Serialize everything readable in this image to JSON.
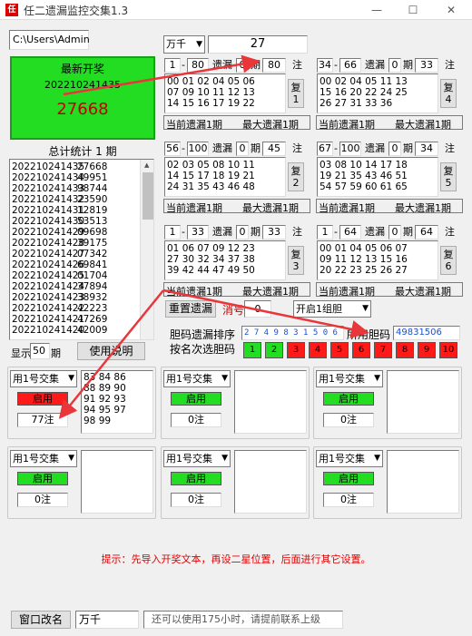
{
  "window": {
    "title": "任二遗漏监控交集1.3",
    "minimize": "—",
    "maximize": "☐",
    "close": "✕"
  },
  "path_input": "C:\\Users\\Admin",
  "latest": {
    "title": "最新开奖",
    "issue": "202210241435",
    "number": "27668"
  },
  "stats": {
    "title": "总计统计 1 期"
  },
  "history": [
    {
      "issue": "202210241435",
      "num": "27668"
    },
    {
      "issue": "202210241434",
      "num": "49951"
    },
    {
      "issue": "202210241433",
      "num": "98744"
    },
    {
      "issue": "202210241432",
      "num": "23590"
    },
    {
      "issue": "202210241431",
      "num": "12819"
    },
    {
      "issue": "202210241430",
      "num": "53513"
    },
    {
      "issue": "202210241429",
      "num": "09698"
    },
    {
      "issue": "202210241428",
      "num": "39175"
    },
    {
      "issue": "202210241427",
      "num": "07342"
    },
    {
      "issue": "202210241426",
      "num": "69841"
    },
    {
      "issue": "202210241425",
      "num": "01704"
    },
    {
      "issue": "202210241424",
      "num": "37894"
    },
    {
      "issue": "202210241423",
      "num": "38932"
    },
    {
      "issue": "202210241422",
      "num": "42223"
    },
    {
      "issue": "202210241421",
      "num": "47269"
    },
    {
      "issue": "202210241420",
      "num": "42009"
    }
  ],
  "display": {
    "label": "显示",
    "value": "50",
    "unit": "期",
    "help": "使用说明"
  },
  "position_select": "万千",
  "position_value": "27",
  "labels": {
    "miss": "遗漏",
    "period": "期",
    "note": "注",
    "cur_miss": "当前遗漏1期",
    "max_miss": "最大遗漏1期",
    "copy": "复"
  },
  "blocks": [
    {
      "from": "1",
      "to": "80",
      "miss": "0",
      "periods": "80",
      "copy": "1",
      "rows": [
        "00 01 02 04 05 06",
        "07 09 10 11 12 13",
        "14 15 16 17 19 22"
      ]
    },
    {
      "from": "34",
      "to": "66",
      "miss": "0",
      "periods": "33",
      "copy": "4",
      "rows": [
        "00 02 04 05 11 13",
        "15 16 20 22 24 25",
        "26 27 31 33 36"
      ]
    },
    {
      "from": "56",
      "to": "100",
      "miss": "0",
      "periods": "45",
      "copy": "2",
      "rows": [
        "02 03 05 08 10 11",
        "14 15 17 18 19 21",
        "24 31 35 43 46 48"
      ]
    },
    {
      "from": "67",
      "to": "100",
      "miss": "0",
      "periods": "34",
      "copy": "5",
      "rows": [
        "03 08 10 14 17 18",
        "19 21 35 43 46 51",
        "54 57 59 60 61 65"
      ]
    },
    {
      "from": "1",
      "to": "33",
      "miss": "0",
      "periods": "33",
      "copy": "3",
      "rows": [
        "01 06 07 09 12 23",
        "27 30 32 34 37 38",
        "39 42 44 47 49 50"
      ]
    },
    {
      "from": "1",
      "to": "64",
      "miss": "0",
      "periods": "64",
      "copy": "6",
      "rows": [
        "00 01 04 05 06 07",
        "09 11 12 13 15 16",
        "20 22 23 25 26 27"
      ]
    }
  ],
  "reset_button": "重置遗漏",
  "kill_label": "消号",
  "kill_value": "0",
  "group_select": "开启1组胆",
  "dan_sort_label": "胆码遗漏排序",
  "dan_sort_value": "2 7 4 9 8 3 1 5 0 6",
  "used_dan_label": "所用胆码",
  "used_dan_value": "49831506",
  "rank_label": "按名次选胆码",
  "rank_buttons": [
    {
      "label": "1",
      "color": "#22dd22"
    },
    {
      "label": "2",
      "color": "#22dd22"
    },
    {
      "label": "3",
      "color": "#ff1a1a"
    },
    {
      "label": "4",
      "color": "#ff1a1a"
    },
    {
      "label": "5",
      "color": "#ff1a1a"
    },
    {
      "label": "6",
      "color": "#ff1a1a"
    },
    {
      "label": "7",
      "color": "#ff1a1a"
    },
    {
      "label": "8",
      "color": "#ff1a1a"
    },
    {
      "label": "9",
      "color": "#ff1a1a"
    },
    {
      "label": "10",
      "color": "#ff1a1a"
    }
  ],
  "panels": [
    {
      "select": "用1号交集",
      "toggle": "启用",
      "active": true,
      "count": "77注",
      "rows": [
        "83 84 86",
        "88 89 90",
        "91 92 93",
        "94 95 97",
        "98 99"
      ]
    },
    {
      "select": "用1号交集",
      "toggle": "启用",
      "active": false,
      "count": "0注",
      "rows": []
    },
    {
      "select": "用1号交集",
      "toggle": "启用",
      "active": false,
      "count": "0注",
      "rows": []
    },
    {
      "select": "用1号交集",
      "toggle": "启用",
      "active": false,
      "count": "0注",
      "rows": []
    },
    {
      "select": "用1号交集",
      "toggle": "启用",
      "active": false,
      "count": "0注",
      "rows": []
    },
    {
      "select": "用1号交集",
      "toggle": "启用",
      "active": false,
      "count": "0注",
      "rows": []
    }
  ],
  "hint": "提示：先导入开奖文本，再设二星位置，后面进行其它设置。",
  "bottom": {
    "rename": "窗口改名",
    "name_value": "万千",
    "status": "还可以使用175小时，请提前联系上级"
  },
  "colors": {
    "accent_green": "#22dd22",
    "alert_red": "#ff1a1a",
    "hint_red": "#e00000",
    "arrow_red": "#e8363a"
  }
}
